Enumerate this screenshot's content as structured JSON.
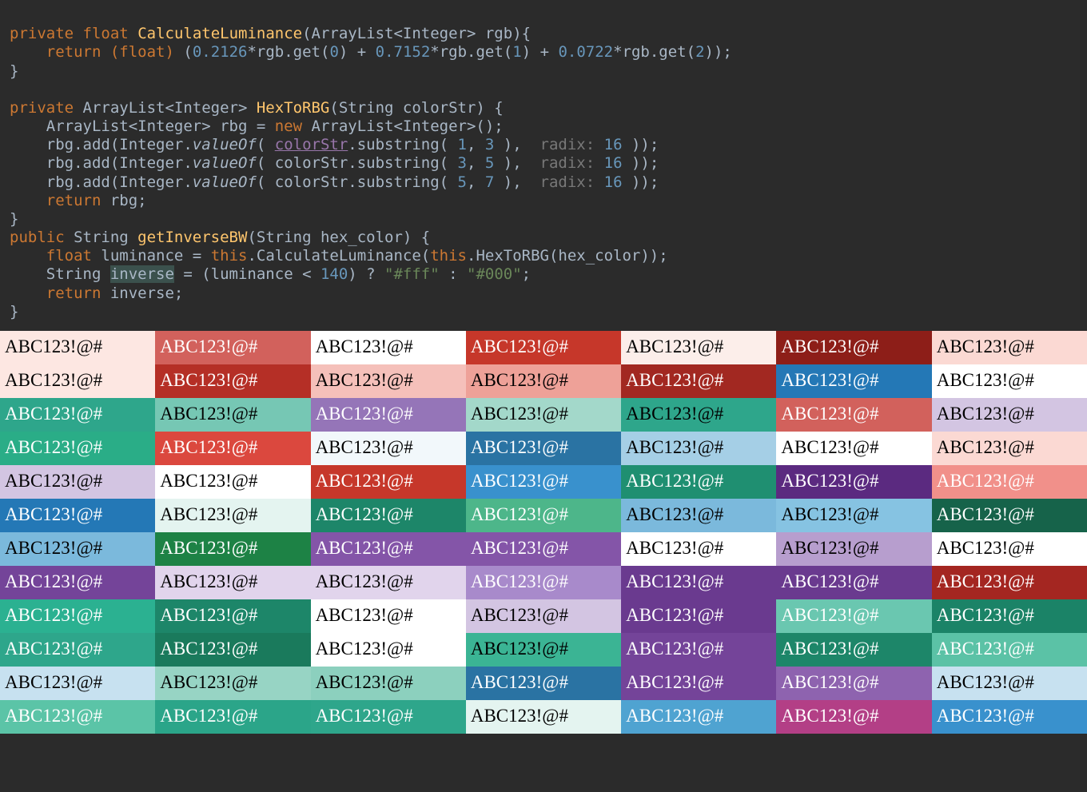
{
  "code": {
    "line1_private": "private",
    "line1_float": "float",
    "line1_fn": "CalculateLuminance",
    "line1_rest": "(ArrayList<Integer> rgb){",
    "line2_return": "return",
    "line2_cast": "(float)",
    "line2_a": "(",
    "line2_n1": "0.2126",
    "line2_m1": "*rgb.get(",
    "line2_i0": "0",
    "line2_p1": ") + ",
    "line2_n2": "0.7152",
    "line2_m2": "*rgb.get(",
    "line2_i1": "1",
    "line2_p2": ") + ",
    "line2_n3": "0.0722",
    "line2_m3": "*rgb.get(",
    "line2_i2": "2",
    "line2_p3": "));",
    "line3": "}",
    "line5_private": "private",
    "line5_sig": " ArrayList<Integer> ",
    "line5_fn": "HexToRBG",
    "line5_rest": "(String colorStr) {",
    "line6_a": "    ArrayList<Integer> rbg = ",
    "line6_new": "new",
    "line6_b": " ArrayList<Integer>();",
    "line7_a": "    rbg.add(Integer.",
    "line7_valueof": "valueOf",
    "line7_b": "( ",
    "line7_colorstr": "colorStr",
    "line7_c": ".substring( ",
    "line7_n1": "1",
    "line7_comma": ", ",
    "line7_n2": "3",
    "line7_d": " ),  ",
    "line7_hint": "radix:",
    "line7_radix": " 16",
    "line7_e": " ));",
    "line8_n1": "3",
    "line8_n2": "5",
    "line9_n1": "5",
    "line9_n2": "7",
    "line10_return": "return",
    "line10_rest": " rbg;",
    "line11": "}",
    "line12_public": "public",
    "line12_sig": " String ",
    "line12_fn": "getInverseBW",
    "line12_rest": "(String hex_color) {",
    "line13_float": "float",
    "line13_a": " luminance = ",
    "line13_this1": "this",
    "line13_b": ".CalculateLuminance(",
    "line13_this2": "this",
    "line13_c": ".HexToRBG(hex_color));",
    "line14_a": "    String ",
    "line14_inverse": "inverse",
    "line14_b": " = (luminance < ",
    "line14_n": "140",
    "line14_c": ") ? ",
    "line14_s1": "\"#fff\"",
    "line14_d": " : ",
    "line14_s2": "\"#000\"",
    "line14_e": ";",
    "line15_return": "return",
    "line15_rest": " inverse;",
    "line16": "}"
  },
  "sample_text": "ABC123!@#",
  "cells": [
    {
      "bg": "#fde7e2",
      "fg": "#000000"
    },
    {
      "bg": "#d2615c",
      "fg": "#ffffff"
    },
    {
      "bg": "#ffffff",
      "fg": "#000000"
    },
    {
      "bg": "#c6372a",
      "fg": "#ffffff"
    },
    {
      "bg": "#fceeea",
      "fg": "#000000"
    },
    {
      "bg": "#8d1e18",
      "fg": "#ffffff"
    },
    {
      "bg": "#fbd9d3",
      "fg": "#000000"
    },
    {
      "bg": "#fde7e2",
      "fg": "#000000"
    },
    {
      "bg": "#b52f26",
      "fg": "#ffffff"
    },
    {
      "bg": "#f5c0ba",
      "fg": "#000000"
    },
    {
      "bg": "#eea198",
      "fg": "#000000"
    },
    {
      "bg": "#a22821",
      "fg": "#ffffff"
    },
    {
      "bg": "#2478b6",
      "fg": "#ffffff"
    },
    {
      "bg": "#ffffff",
      "fg": "#000000"
    },
    {
      "bg": "#2ea68b",
      "fg": "#ffffff"
    },
    {
      "bg": "#76c7b4",
      "fg": "#000000"
    },
    {
      "bg": "#9575b8",
      "fg": "#ffffff"
    },
    {
      "bg": "#a3d8ca",
      "fg": "#000000"
    },
    {
      "bg": "#2ea68b",
      "fg": "#000000"
    },
    {
      "bg": "#d2615c",
      "fg": "#ffffff"
    },
    {
      "bg": "#d3c5e2",
      "fg": "#000000"
    },
    {
      "bg": "#2aad87",
      "fg": "#ffffff"
    },
    {
      "bg": "#db483e",
      "fg": "#ffffff"
    },
    {
      "bg": "#f2f8fb",
      "fg": "#000000"
    },
    {
      "bg": "#2a73a3",
      "fg": "#ffffff"
    },
    {
      "bg": "#a5cfe6",
      "fg": "#000000"
    },
    {
      "bg": "#ffffff",
      "fg": "#000000"
    },
    {
      "bg": "#fbd9d3",
      "fg": "#000000"
    },
    {
      "bg": "#d3c5e2",
      "fg": "#000000"
    },
    {
      "bg": "#ffffff",
      "fg": "#000000"
    },
    {
      "bg": "#c6372a",
      "fg": "#ffffff"
    },
    {
      "bg": "#3991cd",
      "fg": "#ffffff"
    },
    {
      "bg": "#1f8f71",
      "fg": "#ffffff"
    },
    {
      "bg": "#5b2a80",
      "fg": "#ffffff"
    },
    {
      "bg": "#f1908a",
      "fg": "#ffffff"
    },
    {
      "bg": "#2478b6",
      "fg": "#ffffff"
    },
    {
      "bg": "#e4f4f0",
      "fg": "#000000"
    },
    {
      "bg": "#1d8669",
      "fg": "#ffffff"
    },
    {
      "bg": "#4db68a",
      "fg": "#ffffff"
    },
    {
      "bg": "#7bb9dc",
      "fg": "#000000"
    },
    {
      "bg": "#86c3e2",
      "fg": "#000000"
    },
    {
      "bg": "#16634a",
      "fg": "#ffffff"
    },
    {
      "bg": "#7bb9dc",
      "fg": "#000000"
    },
    {
      "bg": "#1d8245",
      "fg": "#ffffff"
    },
    {
      "bg": "#8455a8",
      "fg": "#ffffff"
    },
    {
      "bg": "#8455a8",
      "fg": "#ffffff"
    },
    {
      "bg": "#ffffff",
      "fg": "#000000"
    },
    {
      "bg": "#b79ece",
      "fg": "#000000"
    },
    {
      "bg": "#ffffff",
      "fg": "#000000"
    },
    {
      "bg": "#744499",
      "fg": "#ffffff"
    },
    {
      "bg": "#e1d4ec",
      "fg": "#000000"
    },
    {
      "bg": "#e1d4ec",
      "fg": "#000000"
    },
    {
      "bg": "#a88acb",
      "fg": "#ffffff"
    },
    {
      "bg": "#6a3a8f",
      "fg": "#ffffff"
    },
    {
      "bg": "#6a3a8f",
      "fg": "#ffffff"
    },
    {
      "bg": "#a42621",
      "fg": "#ffffff"
    },
    {
      "bg": "#2bb191",
      "fg": "#ffffff"
    },
    {
      "bg": "#1d8669",
      "fg": "#ffffff"
    },
    {
      "bg": "#ffffff",
      "fg": "#000000"
    },
    {
      "bg": "#d3c5e2",
      "fg": "#000000"
    },
    {
      "bg": "#6a3a8f",
      "fg": "#ffffff"
    },
    {
      "bg": "#6ac7b0",
      "fg": "#ffffff"
    },
    {
      "bg": "#1b8367",
      "fg": "#ffffff"
    },
    {
      "bg": "#2ea68b",
      "fg": "#ffffff"
    },
    {
      "bg": "#1a7a5c",
      "fg": "#ffffff"
    },
    {
      "bg": "#ffffff",
      "fg": "#000000"
    },
    {
      "bg": "#3bb494",
      "fg": "#000000"
    },
    {
      "bg": "#744499",
      "fg": "#ffffff"
    },
    {
      "bg": "#1d8669",
      "fg": "#ffffff"
    },
    {
      "bg": "#5bc2a6",
      "fg": "#ffffff"
    },
    {
      "bg": "#c7e1f0",
      "fg": "#000000"
    },
    {
      "bg": "#97d4c4",
      "fg": "#000000"
    },
    {
      "bg": "#8cd0be",
      "fg": "#000000"
    },
    {
      "bg": "#2a73a3",
      "fg": "#ffffff"
    },
    {
      "bg": "#744499",
      "fg": "#ffffff"
    },
    {
      "bg": "#8e63af",
      "fg": "#ffffff"
    },
    {
      "bg": "#c7e1f0",
      "fg": "#000000"
    },
    {
      "bg": "#5bc4a7",
      "fg": "#ffffff"
    },
    {
      "bg": "#2ba589",
      "fg": "#ffffff"
    },
    {
      "bg": "#2ea68b",
      "fg": "#ffffff"
    },
    {
      "bg": "#e4f4f0",
      "fg": "#000000"
    },
    {
      "bg": "#4fa3d1",
      "fg": "#ffffff"
    },
    {
      "bg": "#b33f86",
      "fg": "#ffffff"
    },
    {
      "bg": "#3991cd",
      "fg": "#ffffff"
    }
  ]
}
